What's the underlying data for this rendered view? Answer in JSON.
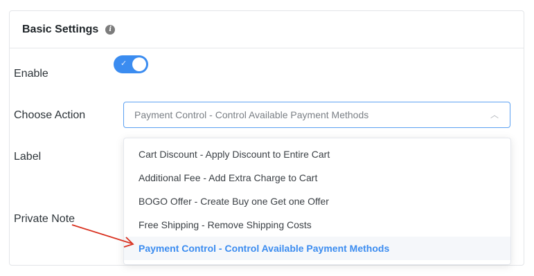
{
  "card": {
    "title": "Basic Settings",
    "info_icon": "info-icon"
  },
  "enable": {
    "label": "Enable",
    "toggle_on": true,
    "check_glyph": "✓"
  },
  "choose_action": {
    "label": "Choose Action",
    "selected_value": "Payment Control - Control Available Payment Methods",
    "chevron": "^"
  },
  "label_row": {
    "label": "Label"
  },
  "private_note": {
    "label": "Private Note"
  },
  "dropdown": {
    "options": [
      "Cart Discount - Apply Discount to Entire Cart",
      "Additional Fee - Add Extra Charge to Cart",
      "BOGO Offer - Create Buy one Get one Offer",
      "Free Shipping - Remove Shipping Costs",
      "Payment Control - Control Available Payment Methods"
    ],
    "selected_index": 4
  },
  "colors": {
    "accent": "#3b8cf0",
    "arrow": "#d9301e"
  }
}
